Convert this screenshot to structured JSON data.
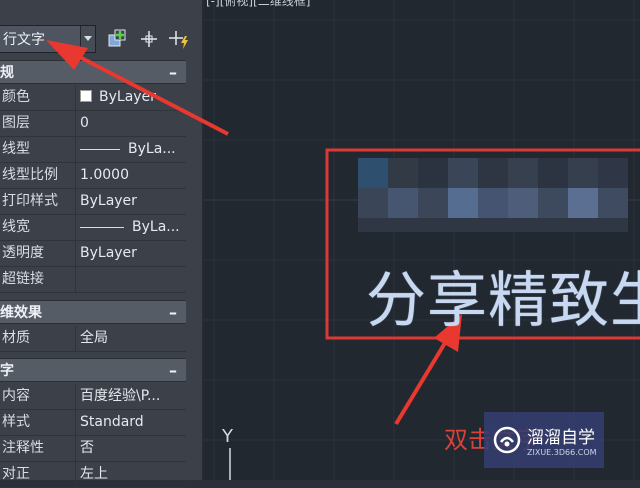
{
  "viewport": {
    "label": "[-][俯视][二维线框]"
  },
  "toolbar": {
    "object_type": "行文字"
  },
  "sections": {
    "general": {
      "title": "规",
      "collapse": "–",
      "rows": [
        {
          "label": "颜色",
          "value": "ByLayer"
        },
        {
          "label": "图层",
          "value": "0"
        },
        {
          "label": "线型",
          "value": "ByLa..."
        },
        {
          "label": "线型比例",
          "value": "1.0000"
        },
        {
          "label": "打印样式",
          "value": "ByLayer"
        },
        {
          "label": "线宽",
          "value": "ByLa..."
        },
        {
          "label": "透明度",
          "value": "ByLayer"
        },
        {
          "label": "超链接",
          "value": ""
        }
      ]
    },
    "3d": {
      "title": "维效果",
      "collapse": "–",
      "rows": [
        {
          "label": "材质",
          "value": "全局"
        }
      ]
    },
    "text": {
      "title": "字",
      "collapse": "–",
      "rows": [
        {
          "label": "内容",
          "value": "百度经验\\P..."
        },
        {
          "label": "样式",
          "value": "Standard"
        },
        {
          "label": "注释性",
          "value": "否"
        },
        {
          "label": "对正",
          "value": "左上"
        }
      ]
    }
  },
  "drawing": {
    "mtext": "分享精致生",
    "annotation": "双击文字",
    "ucs_y": "Y"
  },
  "watermark": {
    "name": "溜溜自学",
    "url": "ZIXUE.3D66.COM"
  },
  "colors": {
    "highlight_box": "#d93a33",
    "arrow": "#e8382f",
    "mtext": "#c8d8f0"
  }
}
